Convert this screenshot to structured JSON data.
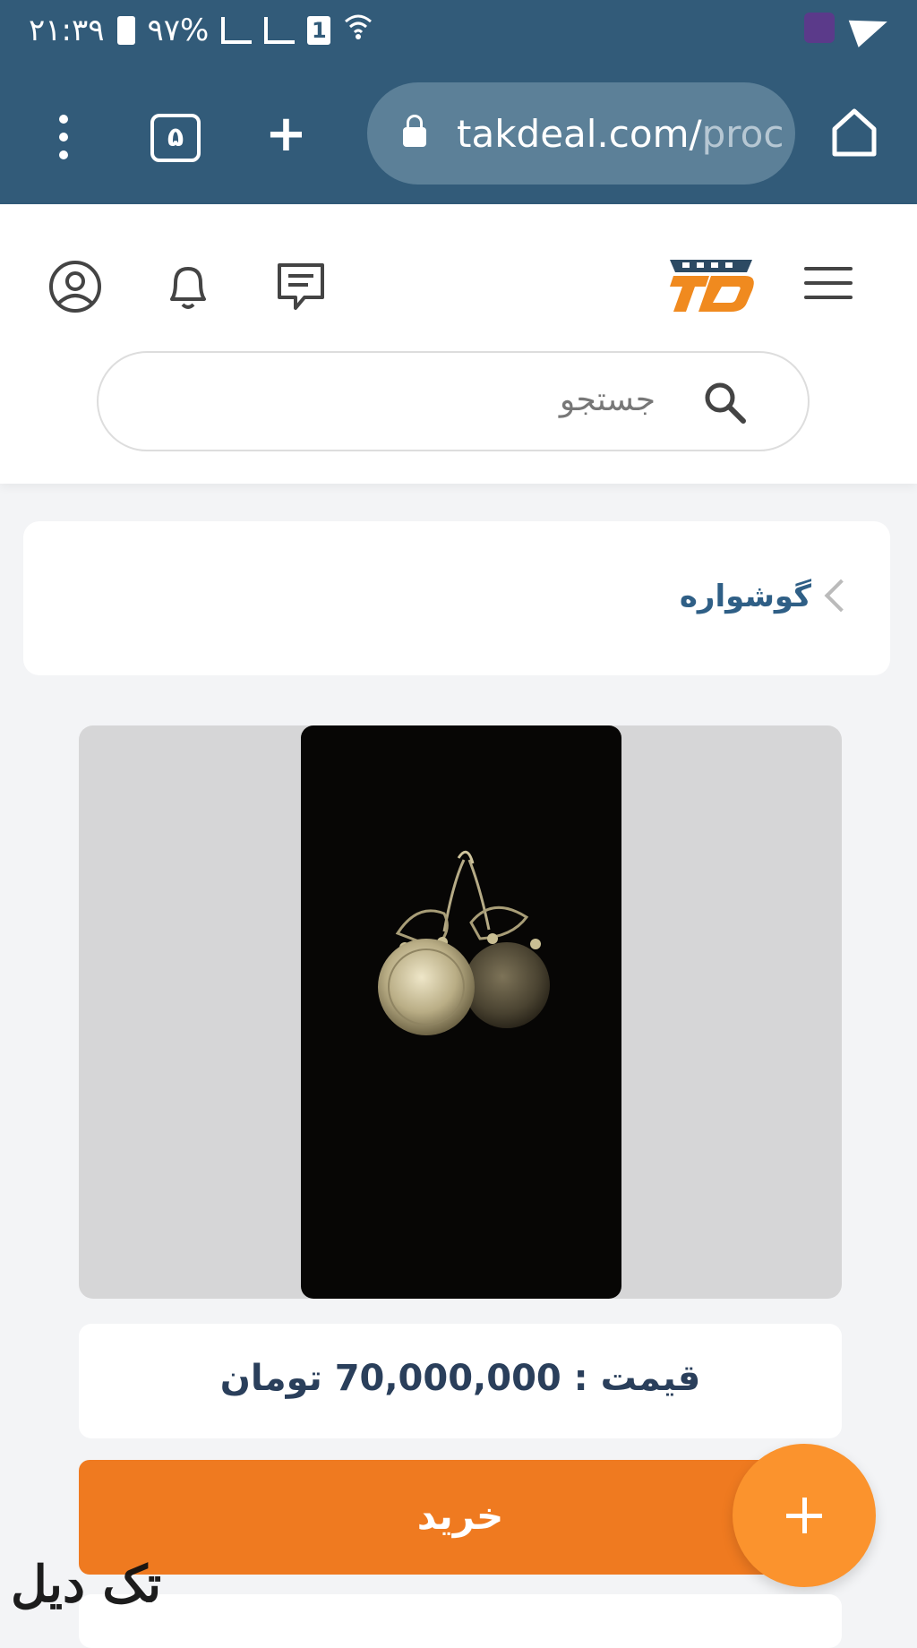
{
  "status_bar": {
    "time": "۲۱:۳۹",
    "battery": "۹۷%",
    "sim_slot": "1"
  },
  "browser": {
    "tab_count": "۵",
    "url_main": "takdeal.com/",
    "url_faded": "proc"
  },
  "header": {
    "search_placeholder": "جستجو"
  },
  "breadcrumb": {
    "label": "گوشواره"
  },
  "product": {
    "price_text": "قیمت : 70,000,000 تومان",
    "buy_label": "خرید"
  },
  "watermark": "تک دیل",
  "colors": {
    "browser_bar": "#325b79",
    "accent_orange": "#ef7a20",
    "fab_orange": "#fb932d",
    "link_blue": "#2f5f86"
  }
}
